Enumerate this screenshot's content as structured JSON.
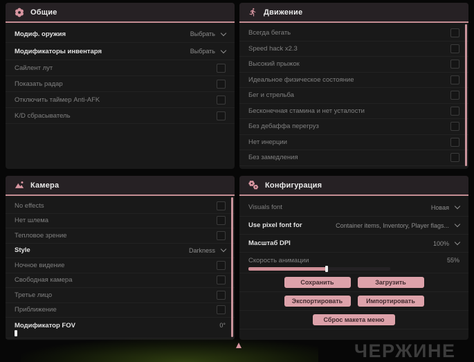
{
  "colors": {
    "accent_pink": "#d795a0",
    "header_underline": "#c48d93",
    "button_bg": "#dda2aa",
    "button_text": "#40292d",
    "scrollbar": "#c9939b",
    "slider_fill": "#cf8f97"
  },
  "panels": {
    "general": {
      "title": "Общие",
      "icon": "flower-icon",
      "rows": [
        {
          "label": "Модиф. оружия",
          "type": "dropdown",
          "value": "Выбрать"
        },
        {
          "label": "Модификаторы инвентаря",
          "type": "dropdown",
          "value": "Выбрать"
        },
        {
          "label": "Сайлент лут",
          "type": "checkbox",
          "checked": false
        },
        {
          "label": "Показать радар",
          "type": "checkbox",
          "checked": false
        },
        {
          "label": "Отключить таймер Anti-AFK",
          "type": "checkbox",
          "checked": false
        },
        {
          "label": "K/D сбрасыватель",
          "type": "checkbox",
          "checked": false
        }
      ]
    },
    "movement": {
      "title": "Движение",
      "icon": "runner-icon",
      "rows": [
        {
          "label": "Всегда бегать",
          "type": "checkbox",
          "checked": false
        },
        {
          "label": "Speed hack x2.3",
          "type": "checkbox",
          "checked": false
        },
        {
          "label": "Высокий прыжок",
          "type": "checkbox",
          "checked": false
        },
        {
          "label": "Идеальное физическое состояние",
          "type": "checkbox",
          "checked": false
        },
        {
          "label": "Бег и стрельба",
          "type": "checkbox",
          "checked": false
        },
        {
          "label": "Бесконечная стамина и нет усталости",
          "type": "checkbox",
          "checked": false
        },
        {
          "label": "Без дебаффа перегруз",
          "type": "checkbox",
          "checked": false
        },
        {
          "label": "Нет инерции",
          "type": "checkbox",
          "checked": false
        },
        {
          "label": "Без замедления",
          "type": "checkbox",
          "checked": false
        }
      ]
    },
    "camera": {
      "title": "Камера",
      "icon": "image-icon",
      "rows": [
        {
          "label": "No effects",
          "type": "checkbox",
          "checked": false
        },
        {
          "label": "Нет шлема",
          "type": "checkbox",
          "checked": false
        },
        {
          "label": "Тепловое зрение",
          "type": "checkbox",
          "checked": false
        },
        {
          "label": "Style",
          "type": "dropdown",
          "value": "Darkness"
        },
        {
          "label": "Ночное видение",
          "type": "checkbox",
          "checked": false
        },
        {
          "label": "Свободная камера",
          "type": "checkbox",
          "checked": false
        },
        {
          "label": "Третье лицо",
          "type": "checkbox",
          "checked": false
        },
        {
          "label": "Приближение",
          "type": "checkbox",
          "checked": false
        },
        {
          "label": "Модификатор FOV",
          "type": "slider",
          "value": "0°",
          "percent": 0
        }
      ]
    },
    "config": {
      "title": "Конфигурация",
      "icon": "gears-icon",
      "rows": [
        {
          "label": "Visuals font",
          "type": "dropdown",
          "value": "Новая"
        },
        {
          "label": "Use pixel font for",
          "type": "dropdown",
          "value": "Container items, Inventory, Player flags..."
        },
        {
          "label": "Масштаб DPI",
          "type": "dropdown",
          "value": "100%"
        },
        {
          "label": "Скорость анимации",
          "type": "slider",
          "value": "55%",
          "percent": 55
        }
      ],
      "buttons": [
        "Сохранить",
        "Загрузить",
        "Экспортировать",
        "Импортировать",
        "Сброс макета меню"
      ]
    }
  },
  "watermark": "ЧЕРЖИНЕ"
}
